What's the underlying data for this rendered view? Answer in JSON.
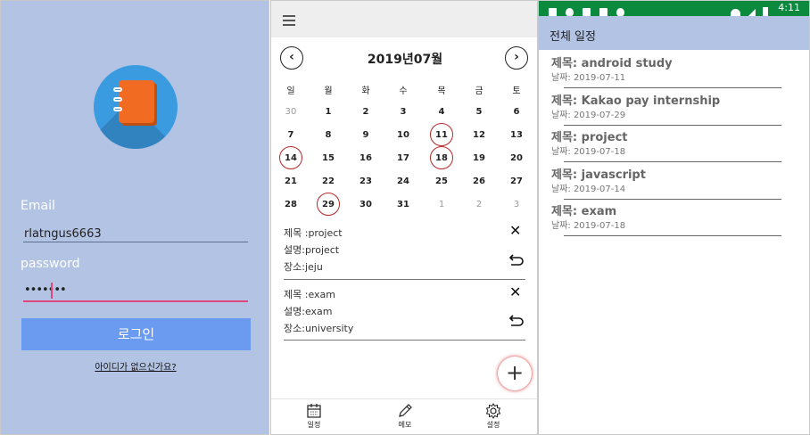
{
  "login": {
    "email_label": "Email",
    "email_value": "rlatngus6663",
    "password_label": "password",
    "password_value": "•••••••",
    "login_button": "로그인",
    "signup_link": "아이디가 없으신가요?",
    "colors": {
      "background": "#b2c3e3",
      "button": "#6a9bf0",
      "focus": "#e0457b",
      "logo_circle": "#3a9be0",
      "logo_book": "#f26b22"
    },
    "logo_icon": "notebook-logo-icon"
  },
  "calendar": {
    "menu_icon": "hamburger-menu-icon",
    "prev_icon": "chevron-left-circle-icon",
    "next_icon": "chevron-right-circle-icon",
    "title": "2019년07월",
    "weekdays": [
      "일",
      "월",
      "화",
      "수",
      "목",
      "금",
      "토"
    ],
    "weeks": [
      [
        {
          "d": "30",
          "dim": true
        },
        {
          "d": "1"
        },
        {
          "d": "2"
        },
        {
          "d": "3"
        },
        {
          "d": "4"
        },
        {
          "d": "5"
        },
        {
          "d": "6"
        }
      ],
      [
        {
          "d": "7"
        },
        {
          "d": "8"
        },
        {
          "d": "9"
        },
        {
          "d": "10"
        },
        {
          "d": "11",
          "mark": true
        },
        {
          "d": "12"
        },
        {
          "d": "13"
        }
      ],
      [
        {
          "d": "14",
          "mark": true
        },
        {
          "d": "15"
        },
        {
          "d": "16"
        },
        {
          "d": "17"
        },
        {
          "d": "18",
          "mark": true
        },
        {
          "d": "19"
        },
        {
          "d": "20"
        }
      ],
      [
        {
          "d": "21"
        },
        {
          "d": "22"
        },
        {
          "d": "23"
        },
        {
          "d": "24"
        },
        {
          "d": "25"
        },
        {
          "d": "26"
        },
        {
          "d": "27"
        }
      ],
      [
        {
          "d": "28"
        },
        {
          "d": "29",
          "mark": true
        },
        {
          "d": "30"
        },
        {
          "d": "31"
        },
        {
          "d": "1",
          "dim": true
        },
        {
          "d": "2",
          "dim": true
        },
        {
          "d": "3",
          "dim": true
        }
      ]
    ],
    "events": [
      {
        "title": "제목 :project",
        "desc": "설명:project",
        "place": "장소:jeju"
      },
      {
        "title": "제목 :exam",
        "desc": "설명:exam",
        "place": "장소:university"
      }
    ],
    "delete_icon": "close-icon",
    "undo_icon": "undo-icon",
    "fab_icon": "plus-icon",
    "bottom_nav": [
      {
        "label": "일정",
        "icon": "calendar-icon"
      },
      {
        "label": "메모",
        "icon": "pencil-icon"
      },
      {
        "label": "설정",
        "icon": "gear-icon"
      }
    ],
    "colors": {
      "mark": "#b52a2a",
      "fab_shadow": "#e06a6a"
    }
  },
  "schedule_list": {
    "status_time": "4:11",
    "title": "전체 일정",
    "items": [
      {
        "title": "제목: android study",
        "date": "날짜: 2019-07-11"
      },
      {
        "title": "제목: Kakao pay internship",
        "date": "날짜: 2019-07-29"
      },
      {
        "title": "제목: project",
        "date": "날짜: 2019-07-18"
      },
      {
        "title": "제목: javascript",
        "date": "날짜: 2019-07-14"
      },
      {
        "title": "제목: exam",
        "date": "날짜: 2019-07-18"
      }
    ],
    "colors": {
      "status_bar": "#0b8a3e",
      "app_bar": "#b2c3e3"
    }
  }
}
